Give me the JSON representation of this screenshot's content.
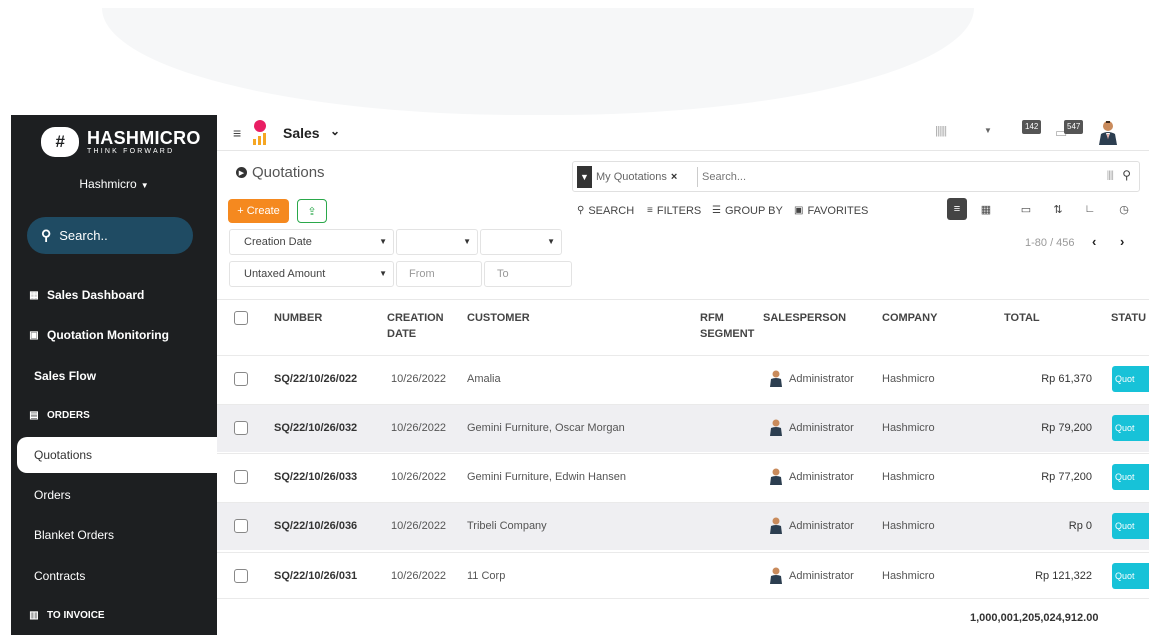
{
  "brand": {
    "name": "HASHMICRO",
    "tagline": "THINK FORWARD",
    "mark": "#"
  },
  "sidebar": {
    "company": "Hashmicro",
    "search_placeholder": "Search..",
    "items": [
      {
        "label": "Sales Dashboard",
        "icon": "dashboard-icon",
        "kind": "main"
      },
      {
        "label": "Quotation Monitoring",
        "icon": "monitor-icon",
        "kind": "main"
      },
      {
        "label": "Sales Flow",
        "icon": "",
        "kind": "main"
      },
      {
        "label": "ORDERS",
        "icon": "clipboard-icon",
        "kind": "section"
      },
      {
        "label": "Quotations",
        "icon": "",
        "kind": "sub",
        "active": true
      },
      {
        "label": "Orders",
        "icon": "",
        "kind": "sub"
      },
      {
        "label": "Blanket Orders",
        "icon": "",
        "kind": "sub"
      },
      {
        "label": "Contracts",
        "icon": "",
        "kind": "sub"
      },
      {
        "label": "TO INVOICE",
        "icon": "invoice-icon",
        "kind": "section"
      }
    ]
  },
  "topbar": {
    "app_name": "Sales",
    "badge_activity": "142",
    "badge_messages": "547"
  },
  "control_panel": {
    "title": "Quotations",
    "facet_label": "My Quotations",
    "facet_remove": "×",
    "search_placeholder": "Search...",
    "create_label": "+ Create",
    "search_option": "SEARCH",
    "filters_option": "FILTERS",
    "group_by_option": "GROUP BY",
    "favorites_option": "FAVORITES",
    "filter_field_1": "Creation Date",
    "filter_field_2": "Untaxed Amount",
    "from_placeholder": "From",
    "to_placeholder": "To",
    "pager": "1-80 / 456",
    "prev": "‹",
    "next": "›"
  },
  "table": {
    "headers": {
      "number": "NUMBER",
      "creation_date": "CREATION DATE",
      "customer": "CUSTOMER",
      "rfm_segment": "RFM SEGMENT",
      "salesperson": "SALESPERSON",
      "company": "COMPANY",
      "total": "TOTAL",
      "status": "STATU"
    },
    "rows": [
      {
        "number": "SQ/22/10/26/022",
        "date": "10/26/2022",
        "customer": "Amalia",
        "salesperson": "Administrator",
        "company": "Hashmicro",
        "total": "Rp 61,370",
        "status": "Quot"
      },
      {
        "number": "SQ/22/10/26/032",
        "date": "10/26/2022",
        "customer": "Gemini Furniture, Oscar Morgan",
        "salesperson": "Administrator",
        "company": "Hashmicro",
        "total": "Rp 79,200",
        "status": "Quot"
      },
      {
        "number": "SQ/22/10/26/033",
        "date": "10/26/2022",
        "customer": "Gemini Furniture, Edwin Hansen",
        "salesperson": "Administrator",
        "company": "Hashmicro",
        "total": "Rp 77,200",
        "status": "Quot"
      },
      {
        "number": "SQ/22/10/26/036",
        "date": "10/26/2022",
        "customer": "Tribeli Company",
        "salesperson": "Administrator",
        "company": "Hashmicro",
        "total": "Rp 0",
        "status": "Quot"
      },
      {
        "number": "SQ/22/10/26/031",
        "date": "10/26/2022",
        "customer": "11 Corp",
        "salesperson": "Administrator",
        "company": "Hashmicro",
        "total": "Rp 121,322",
        "status": "Quot"
      }
    ],
    "grand_total": "1,000,001,205,024,912.00"
  },
  "colors": {
    "sidebar_bg": "#1d1f21",
    "create_btn": "#f5891f",
    "status_pill": "#17c2d8",
    "search_pill": "#1f4b63"
  }
}
